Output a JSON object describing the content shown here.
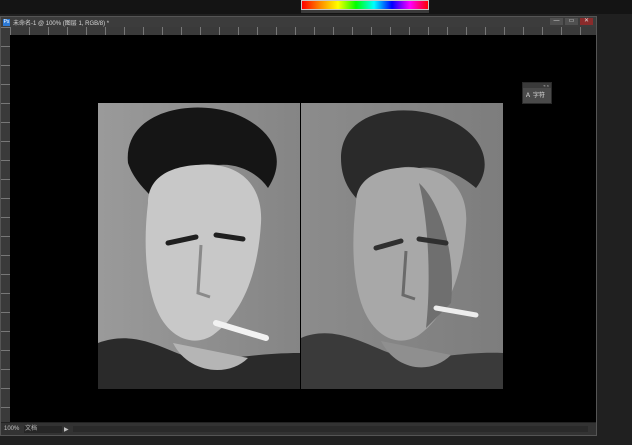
{
  "app": {
    "document_tab": "未命名-1 @ 100% (图层 1, RGB/8) *",
    "titlebar_icon": "Ps"
  },
  "window_controls": {
    "minimize": "—",
    "restore": "▭",
    "close": "✕"
  },
  "float_panel": {
    "header_glyphs": "« ×",
    "label": "字符"
  },
  "status_bar": {
    "zoom": "100%",
    "info": "文档",
    "arrow": "▶"
  },
  "icons": [
    "photoshop-icon",
    "close-icon",
    "character-icon",
    "info-arrow-icon"
  ],
  "colors": {
    "canvas": "#000000",
    "workspace": "#202020",
    "accent": "#2c7ad6"
  }
}
